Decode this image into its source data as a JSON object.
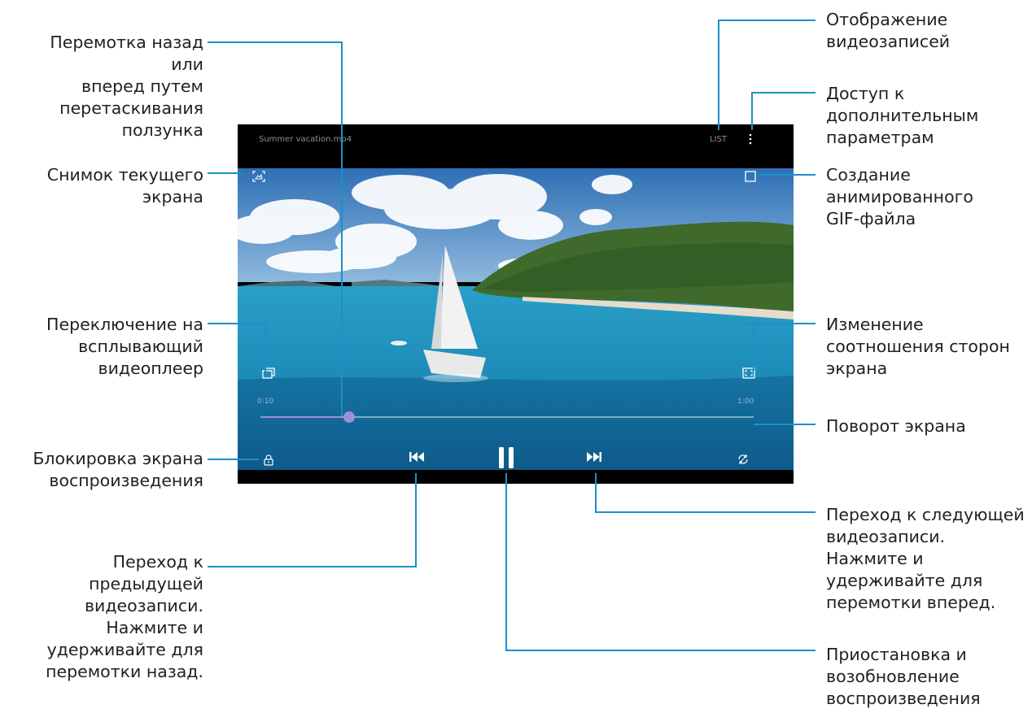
{
  "player": {
    "file_title": "Summer vacation.mp4",
    "list_label": "LIST",
    "time_current": "0:10",
    "time_total": "1:00",
    "progress": 0.18
  },
  "callouts": {
    "seek": "Перемотка назад или\nвперед путем\nперетаскивания\nползунка",
    "capture": "Снимок текущего\nэкрана",
    "popup": "Переключение на\nвсплывающий\nвидеоплеер",
    "lock": "Блокировка экрана\nвоспроизведения",
    "prev": "Переход к\nпредыдущей\nвидеозаписи.\nНажмите и\nудерживайте для\nперемотки назад.",
    "list": "Отображение\nвидеозаписей",
    "more": "Доступ к\nдополнительным\nпараметрам",
    "gif": "Создание\nанимированного\nGIF-файла",
    "ratio": "Изменение\nсоотношения сторон\nэкрана",
    "rotate": "Поворот экрана",
    "next": "Переход к следующей\nвидеозаписи.\nНажмите и\nудерживайте для\nперемотки вперед.",
    "pause": "Приостановка и\nвозобновление\nвоспроизведения"
  },
  "colors": {
    "leader_line": "#1d8fc9",
    "seek_thumb": "#9f8fd6"
  }
}
